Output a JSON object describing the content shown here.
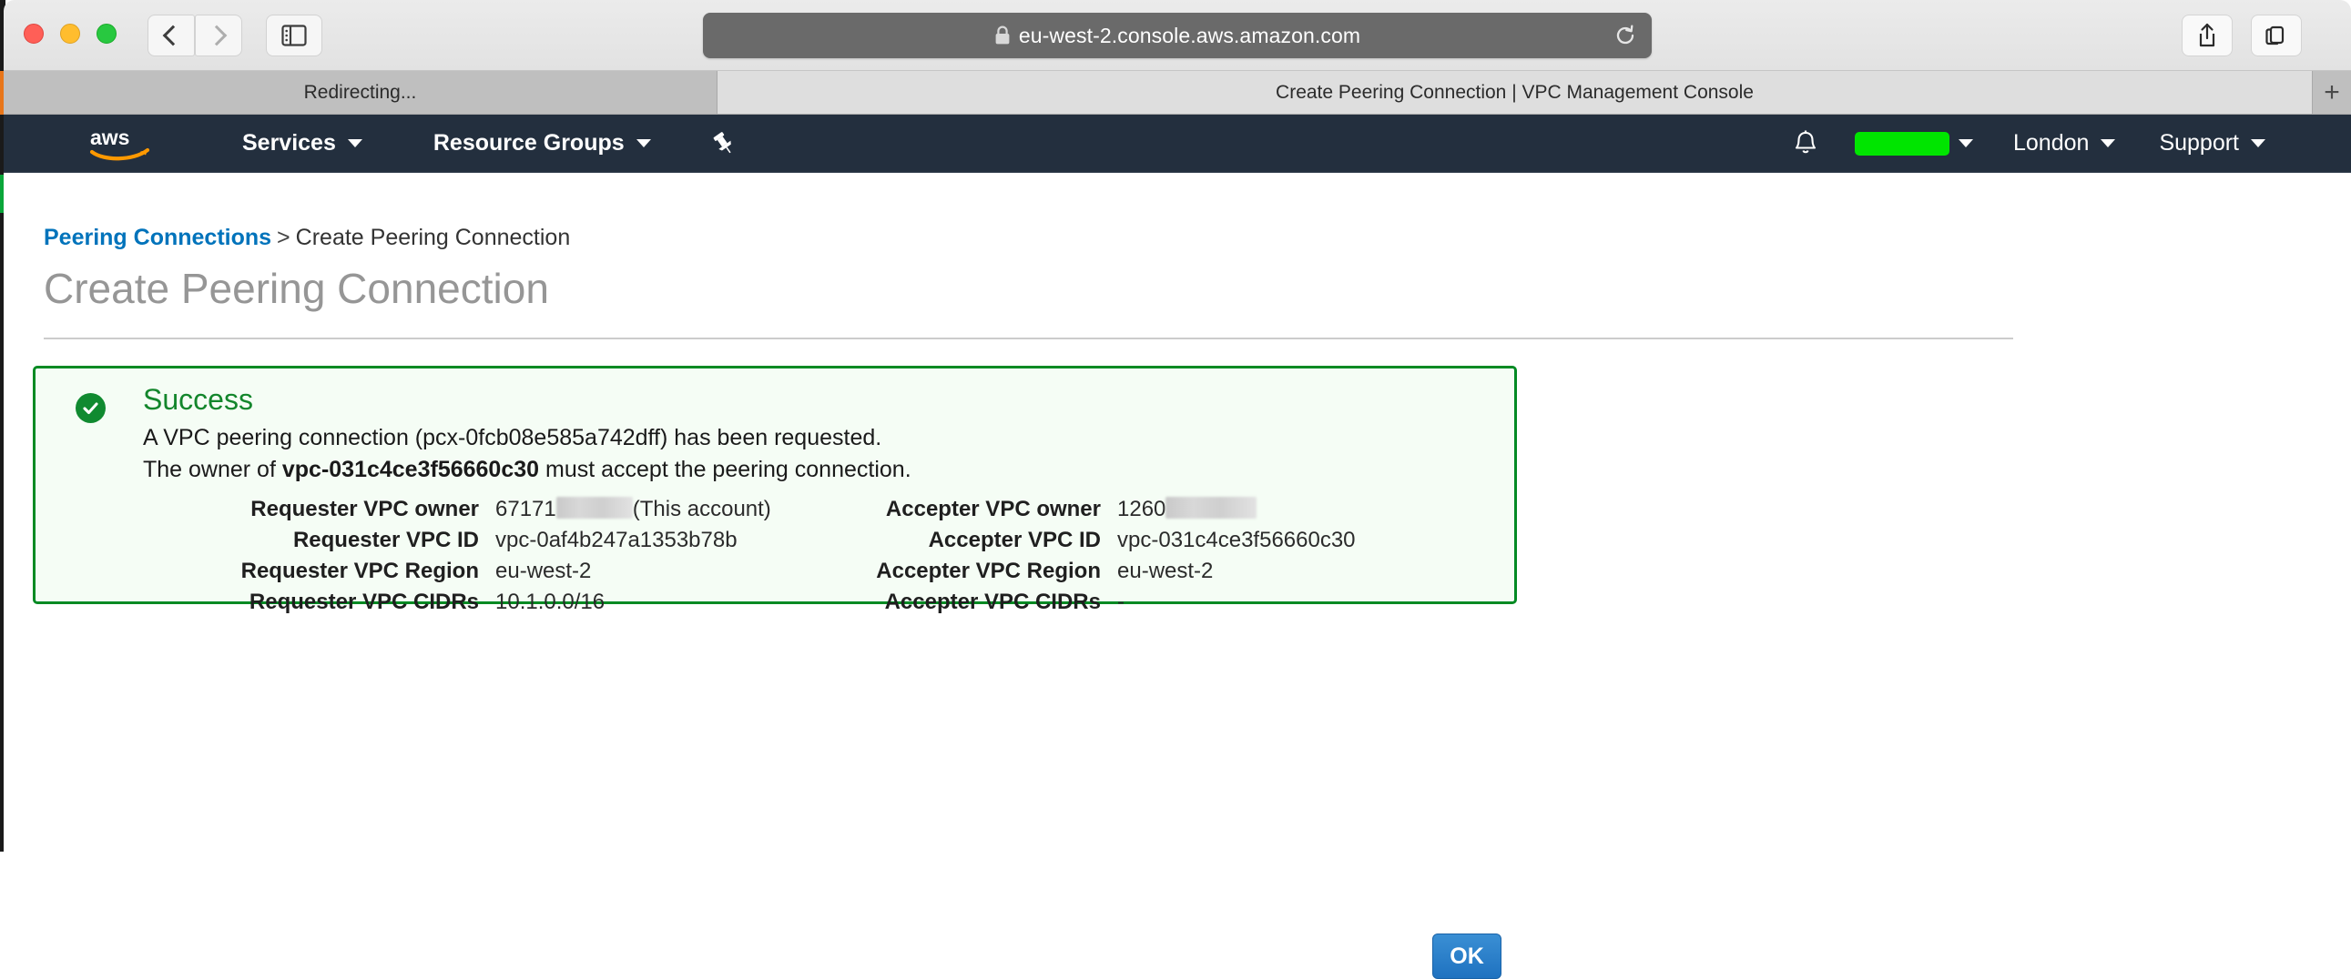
{
  "browser": {
    "name": "safari",
    "url": "eu-west-2.console.aws.amazon.com",
    "lock_icon": "lock-icon",
    "back_icon": "chevron-left-icon",
    "forward_icon": "chevron-right-icon",
    "sidebar_icon": "sidebar-toggle-icon",
    "reload_icon": "reload-icon",
    "share_icon": "share-icon",
    "tabs_icon": "tab-overview-icon",
    "new_tab_label": "+",
    "tabs": [
      {
        "label": "Redirecting...",
        "active": false
      },
      {
        "label": "Create Peering Connection | VPC Management Console",
        "active": true
      }
    ]
  },
  "aws_nav": {
    "logo": "aws-logo",
    "services_label": "Services",
    "resource_groups_label": "Resource Groups",
    "pin_icon": "pushpin-icon",
    "bell_icon": "bell-icon",
    "account_label": "",
    "account_redacted": true,
    "region_label": "London",
    "support_label": "Support",
    "bar_color": "#232f3e"
  },
  "breadcrumb": {
    "link_label": "Peering Connections",
    "separator": ">",
    "current_label": "Create Peering Connection",
    "link_color": "#0073bb"
  },
  "page": {
    "title": "Create Peering Connection"
  },
  "success": {
    "icon": "check-circle-icon",
    "title": "Success",
    "line1": "A VPC peering connection (pcx-0fcb08e585a742dff) has been requested.",
    "line2_prefix": "The owner of ",
    "line2_bold": "vpc-031c4ce3f56660c30",
    "line2_suffix": " must accept the peering connection.",
    "border_color": "#008a23",
    "background_color": "#f5fdf5",
    "title_color": "#13862c",
    "details": [
      {
        "requester_label": "Requester VPC owner",
        "requester_value": "67171",
        "requester_redacted": true,
        "requester_suffix": "(This account)",
        "accepter_label": "Accepter VPC owner",
        "accepter_value": "1260",
        "accepter_redacted": true,
        "accepter_suffix": ""
      },
      {
        "requester_label": "Requester VPC ID",
        "requester_value": "vpc-0af4b247a1353b78b",
        "accepter_label": "Accepter VPC ID",
        "accepter_value": "vpc-031c4ce3f56660c30"
      },
      {
        "requester_label": "Requester VPC Region",
        "requester_value": "eu-west-2",
        "accepter_label": "Accepter VPC Region",
        "accepter_value": "eu-west-2"
      },
      {
        "requester_label": "Requester VPC CIDRs",
        "requester_value": "10.1.0.0/16",
        "accepter_label": "Accepter VPC CIDRs",
        "accepter_value": "-"
      }
    ]
  },
  "actions": {
    "ok_label": "OK",
    "ok_color": "#1f72c0"
  }
}
